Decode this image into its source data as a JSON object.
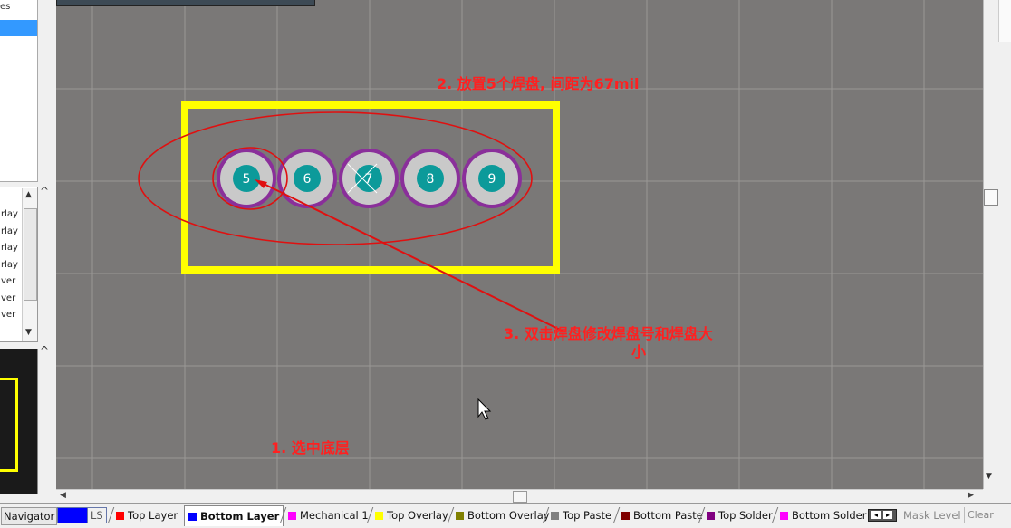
{
  "left_panel": {
    "top_label": "es",
    "list_items": [
      "rlay",
      "rlay",
      "rlay",
      "rlay",
      "ver",
      "ver",
      "ver"
    ]
  },
  "canvas": {
    "background": "#7a7877",
    "board_outline_color": "#ffff00",
    "pad_ring_color": "#8a2f9a",
    "pad_body_color": "#c9c9c9",
    "pad_hole_color": "#0c9a9a",
    "pads": [
      "5",
      "6",
      "7",
      "8",
      "9"
    ],
    "annotation_color": "#ff2020",
    "annotations": {
      "step2": "2. 放置5个焊盘, 间距为67mil",
      "step3_line1": "3. 双击焊盘修改焊盘号和焊盘大",
      "step3_line2": "小",
      "step1": "1. 选中底层"
    }
  },
  "tabs": {
    "navigator": "Navigator",
    "ls": "LS",
    "layers": [
      {
        "label": "Top Layer",
        "color": "#ff0000"
      },
      {
        "label": "Bottom Layer",
        "color": "#0000ff",
        "active": true
      },
      {
        "label": "Mechanical 1",
        "color": "#ff00ff"
      },
      {
        "label": "Top Overlay",
        "color": "#ffff00"
      },
      {
        "label": "Bottom Overlay",
        "color": "#808000"
      },
      {
        "label": "Top Paste",
        "color": "#808080"
      },
      {
        "label": "Bottom Paste",
        "color": "#800000"
      },
      {
        "label": "Top Solder",
        "color": "#800080"
      },
      {
        "label": "Bottom Solder",
        "color": "#ff00ff"
      }
    ],
    "mask_level": "Mask Level",
    "clear": "Clear"
  }
}
